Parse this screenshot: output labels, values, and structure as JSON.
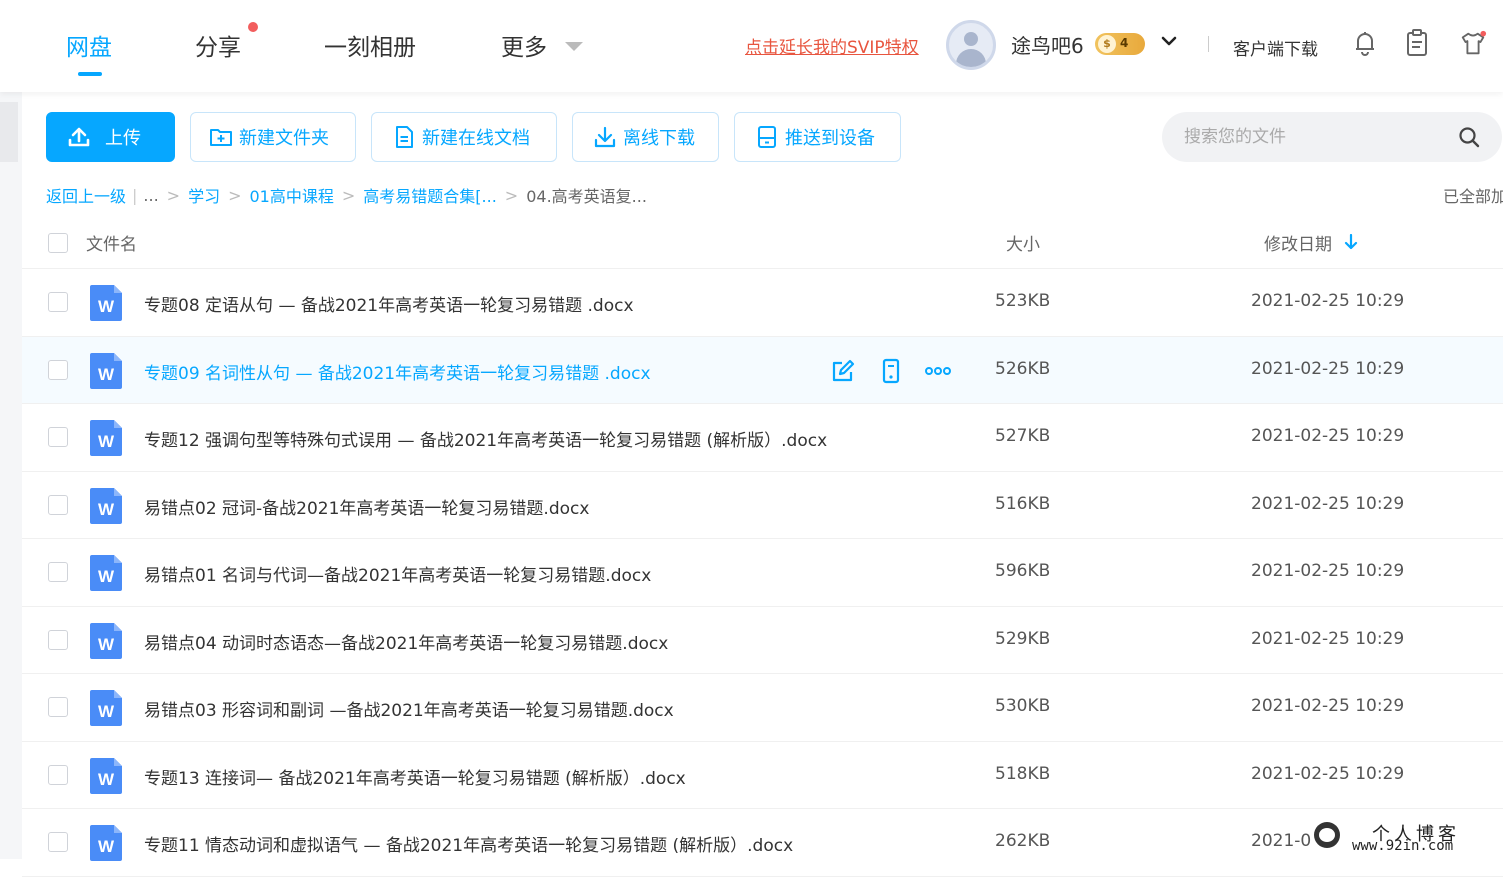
{
  "nav": {
    "tabs": [
      {
        "label": "网盘",
        "active": true
      },
      {
        "label": "分享",
        "has_dot": true
      },
      {
        "label": "一刻相册"
      },
      {
        "label": "更多"
      }
    ]
  },
  "header": {
    "svip_link": "点击延长我的SVIP特权",
    "username": "途鸟吧6",
    "vip_level": "4",
    "vip_coin": "$",
    "client_download": "客户端下载",
    "icons": [
      "bell-icon",
      "clipboard-icon",
      "shirt-icon"
    ]
  },
  "toolbar": {
    "upload": "上传",
    "new_folder": "新建文件夹",
    "new_doc": "新建在线文档",
    "offline_download": "离线下载",
    "push_device": "推送到设备",
    "search_placeholder": "搜索您的文件"
  },
  "breadcrumb": {
    "back": "返回上一级",
    "ellipsis": "...",
    "items": [
      "学习",
      "01高中课程",
      "高考易错题合集[..."
    ],
    "current": "04.高考英语复...",
    "all_loaded": "已全部加载"
  },
  "list": {
    "col_name": "文件名",
    "col_size": "大小",
    "col_date": "修改日期",
    "rows": [
      {
        "name": "专题08 定语从句 — 备战2021年高考英语一轮复习易错题 .docx",
        "size": "523KB",
        "date": "2021-02-25 10:29"
      },
      {
        "name": "专题09 名词性从句 — 备战2021年高考英语一轮复习易错题 .docx",
        "size": "526KB",
        "date": "2021-02-25 10:29"
      },
      {
        "name": "专题12 强调句型等特殊句式误用 — 备战2021年高考英语一轮复习易错题 (解析版）.docx",
        "size": "527KB",
        "date": "2021-02-25 10:29"
      },
      {
        "name": "易错点02 冠词-备战2021年高考英语一轮复习易错题.docx",
        "size": "516KB",
        "date": "2021-02-25 10:29"
      },
      {
        "name": "易错点01 名词与代词—备战2021年高考英语一轮复习易错题.docx",
        "size": "596KB",
        "date": "2021-02-25 10:29"
      },
      {
        "name": "易错点04 动词时态语态—备战2021年高考英语一轮复习易错题.docx",
        "size": "529KB",
        "date": "2021-02-25 10:29"
      },
      {
        "name": "易错点03 形容词和副词 —备战2021年高考英语一轮复习易错题.docx",
        "size": "530KB",
        "date": "2021-02-25 10:29"
      },
      {
        "name": "专题13 连接词— 备战2021年高考英语一轮复习易错题 (解析版）.docx",
        "size": "518KB",
        "date": "2021-02-25 10:29"
      },
      {
        "name": "专题11 情态动词和虚拟语气 — 备战2021年高考英语一轮复习易错题 (解析版）.docx",
        "size": "262KB",
        "date": "2021-0"
      }
    ]
  },
  "watermark": {
    "line1": "个人博客",
    "line2": "www.92in.com"
  },
  "colors": {
    "accent": "#06a7ff",
    "svip": "#e8553f",
    "word": "#4a8cf7"
  }
}
